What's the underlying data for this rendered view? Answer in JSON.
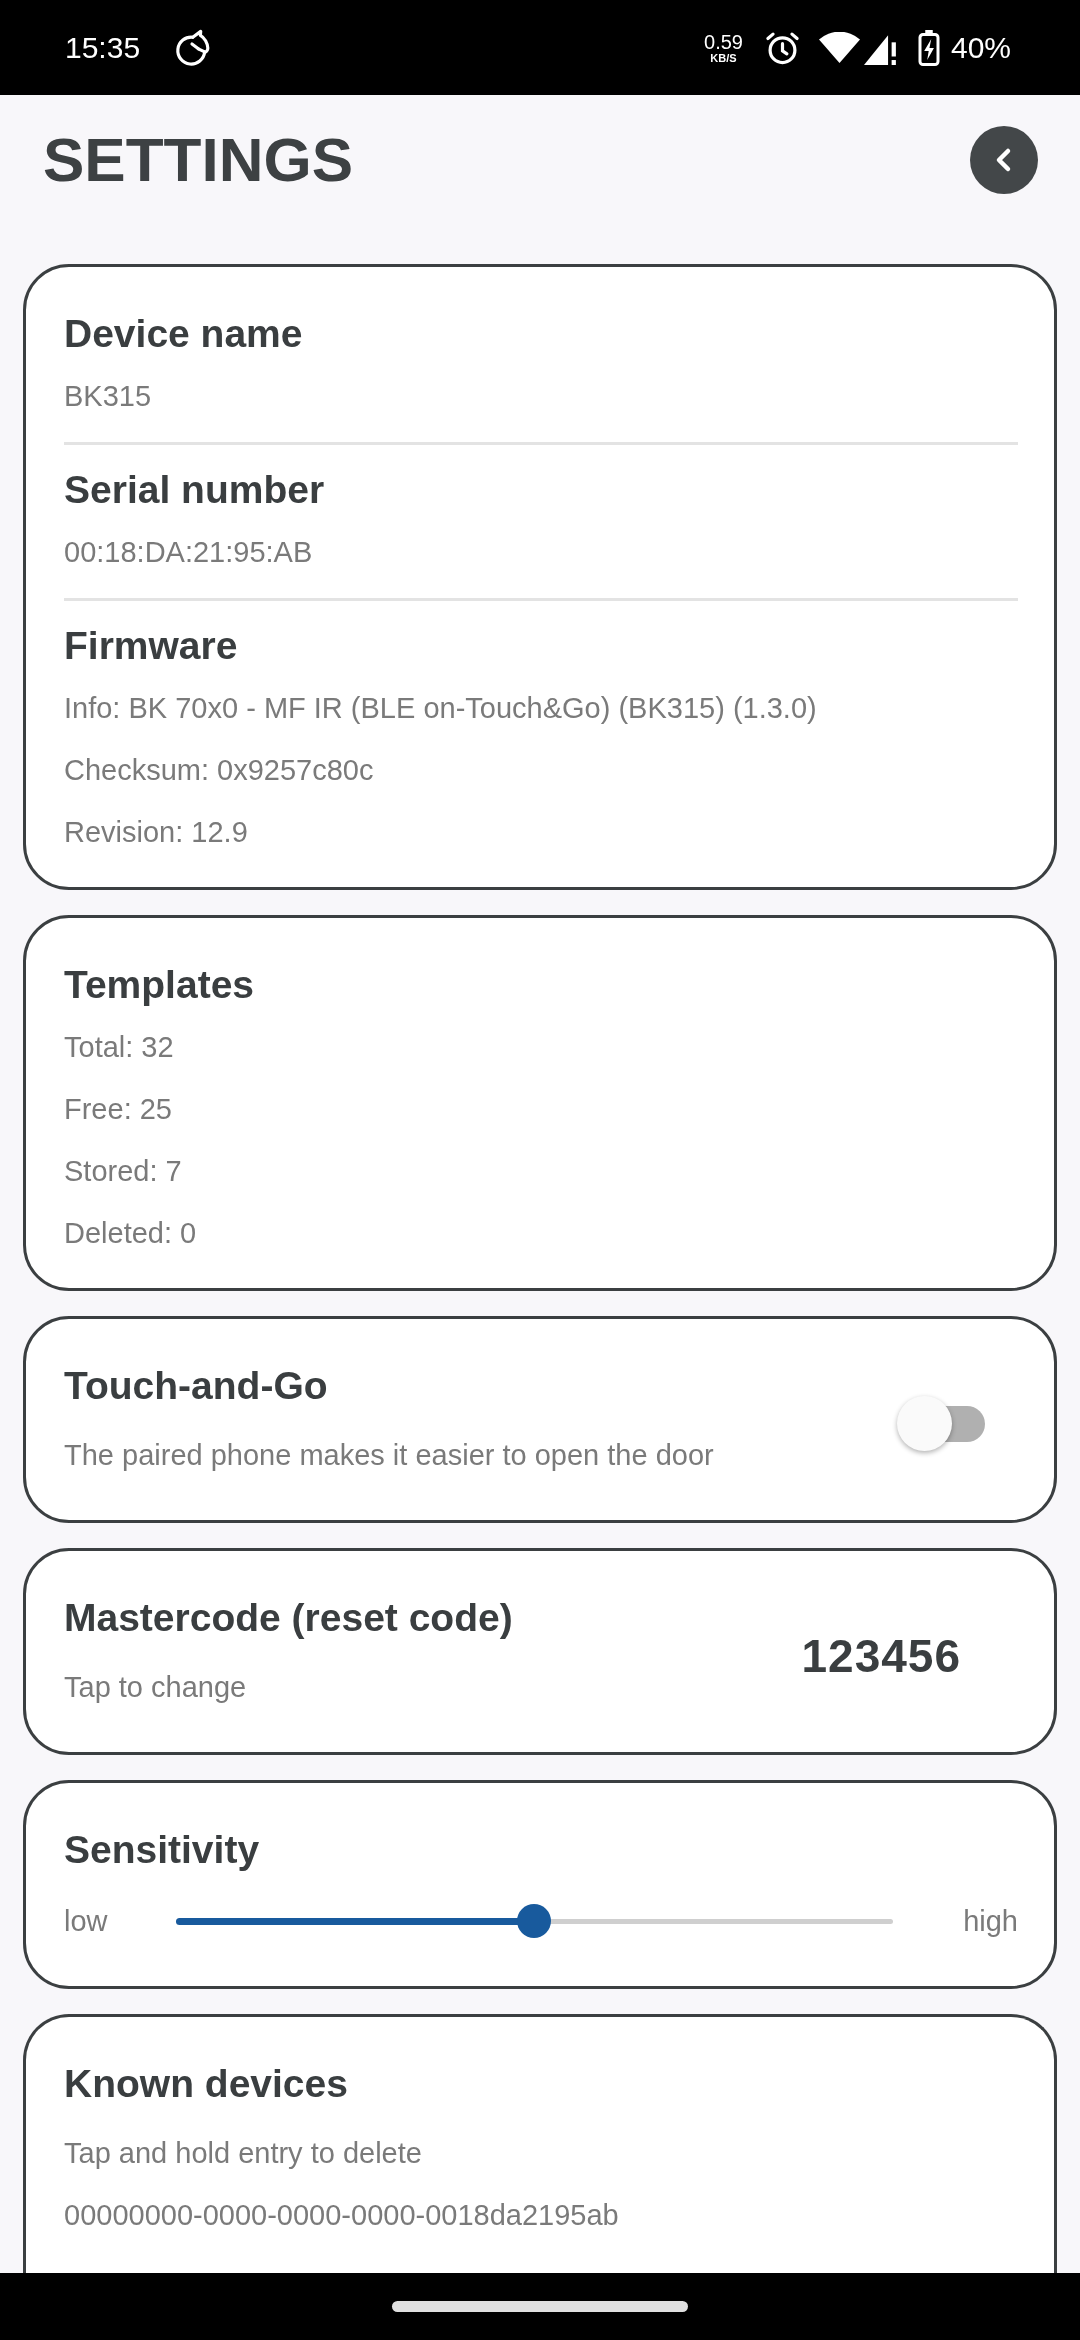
{
  "status_bar": {
    "time": "15:35",
    "net_speed": "0.59",
    "net_speed_unit": "KB/S",
    "battery": "40%"
  },
  "header": {
    "title": "SETTINGS"
  },
  "cards": [
    {
      "kind": "info",
      "sections": [
        {
          "heading": "Device name",
          "values": [
            "BK315"
          ]
        },
        {
          "heading": "Serial number",
          "values": [
            "00:18:DA:21:95:AB"
          ]
        },
        {
          "heading": "Firmware",
          "values": [
            "Info: BK 70x0 - MF IR (BLE on-Touch&Go) (BK315) (1.3.0)",
            "Checksum: 0x9257c80c",
            "Revision: 12.9"
          ]
        }
      ]
    },
    {
      "kind": "info",
      "sections": [
        {
          "heading": "Templates",
          "values": [
            "Total: 32",
            "Free: 25",
            "Stored: 7",
            "Deleted: 0"
          ]
        }
      ]
    },
    {
      "kind": "toggle",
      "heading": "Touch-and-Go",
      "subtitle": "The paired phone makes it easier to open the door",
      "on": false
    },
    {
      "kind": "code",
      "heading": "Mastercode (reset code)",
      "subtitle": "Tap to change",
      "code": "123456"
    },
    {
      "kind": "slider",
      "heading": "Sensitivity",
      "min_label": "low",
      "max_label": "high",
      "level": 0.5
    },
    {
      "kind": "list",
      "heading": "Known devices",
      "subtitle": "Tap and hold entry to delete",
      "entries": [
        "00000000-0000-0000-0000-0018da2195ab"
      ]
    }
  ]
}
